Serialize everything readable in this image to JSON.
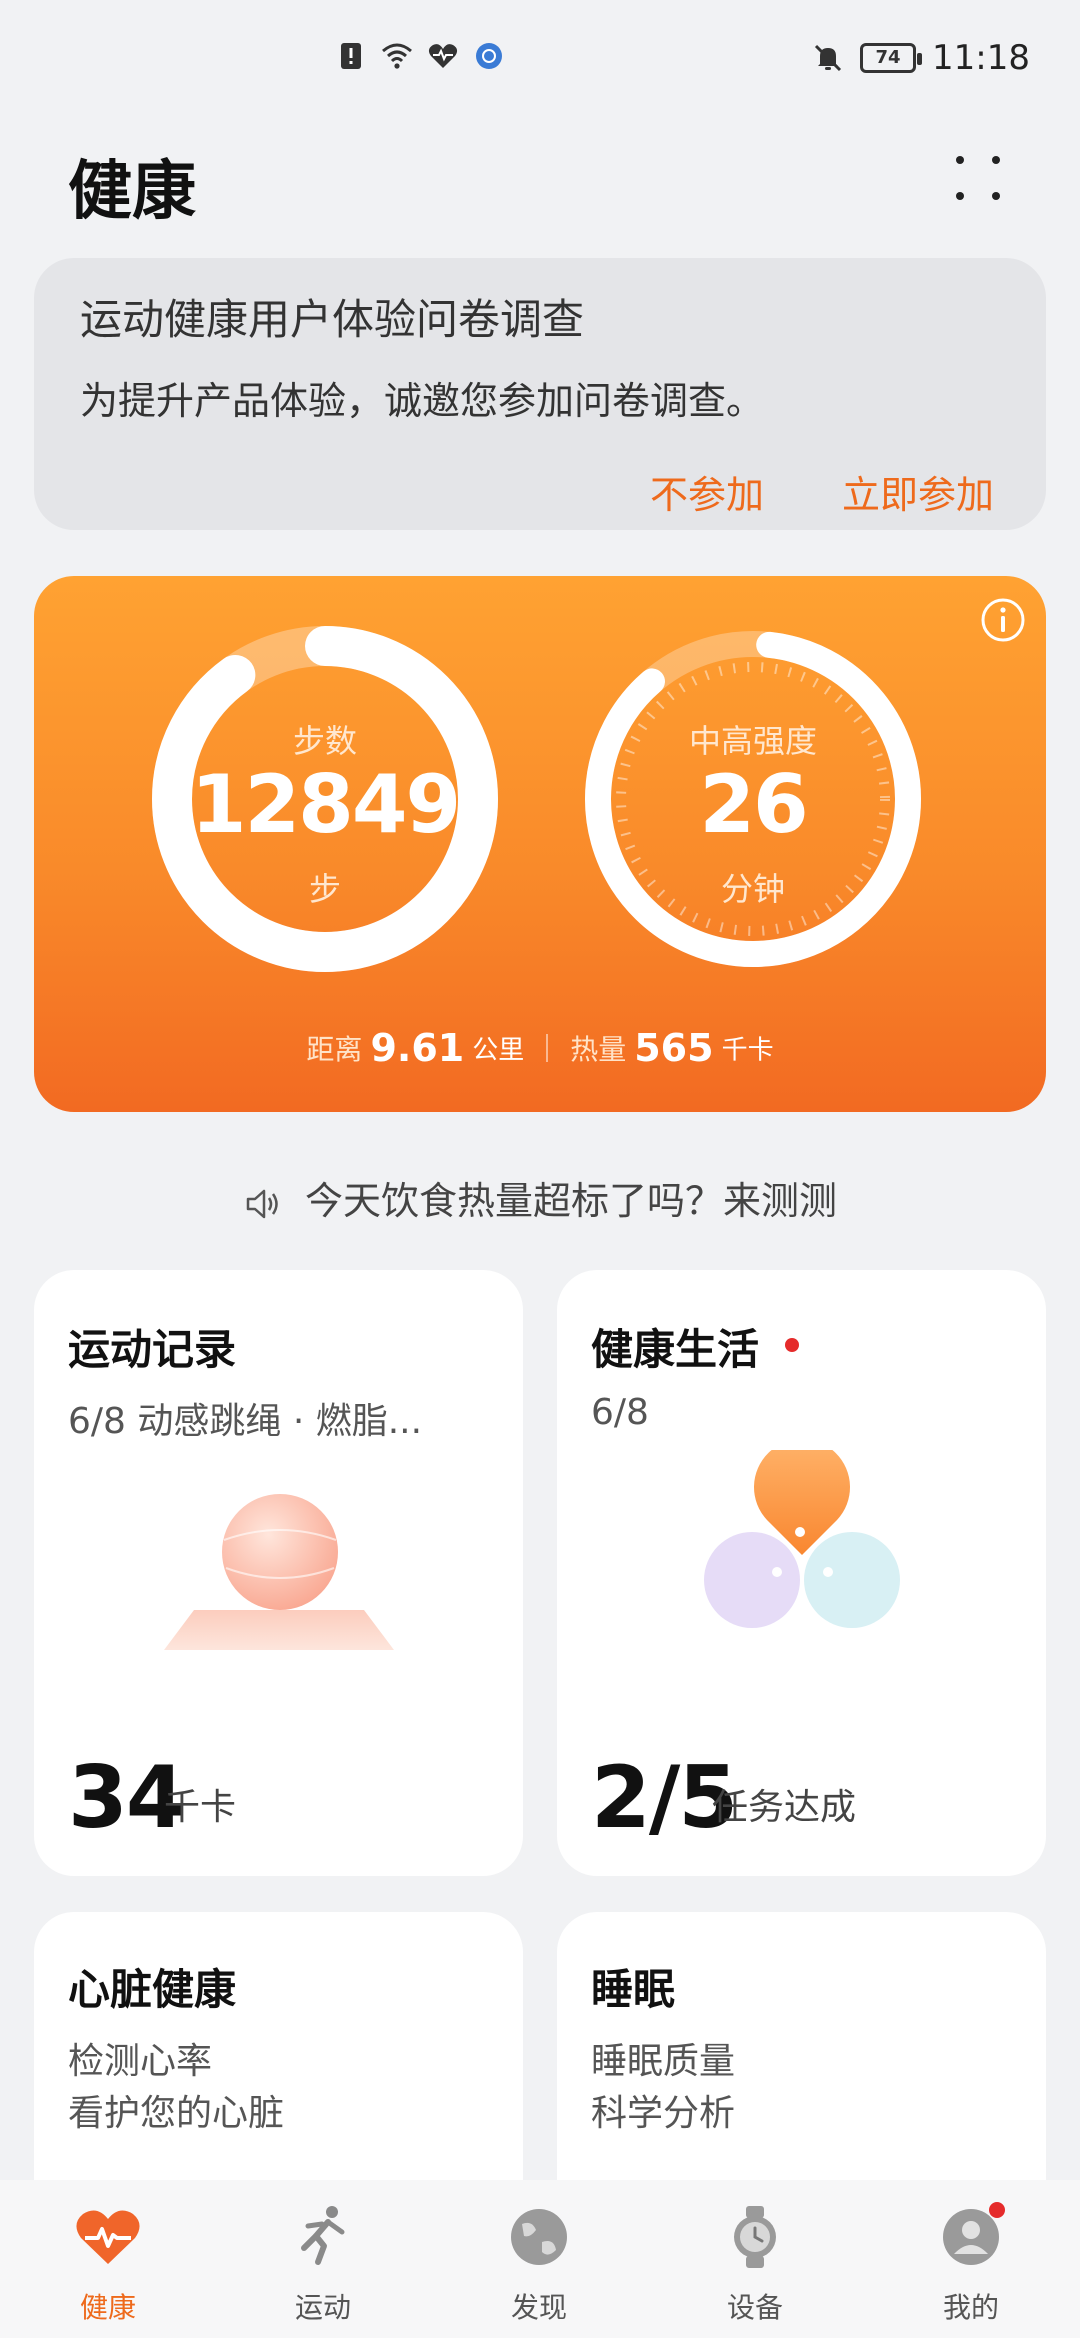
{
  "status_bar": {
    "time": "11:18",
    "battery": "74"
  },
  "header": {
    "title": "健康"
  },
  "survey": {
    "title": "运动健康用户体验问卷调查",
    "description": "为提升产品体验，诚邀您参加问卷调查。",
    "decline_label": "不参加",
    "join_label": "立即参加"
  },
  "activity": {
    "steps": {
      "label": "步数",
      "value": "12849",
      "unit": "步",
      "progress": 0.9
    },
    "intensity": {
      "label": "中高强度",
      "value": "26",
      "unit": "分钟",
      "progress": 0.87
    },
    "distance": {
      "label": "距离",
      "value": "9.61",
      "unit": "公里"
    },
    "calories": {
      "label": "热量",
      "value": "565",
      "unit": "千卡"
    }
  },
  "diet_tip": "今天饮食热量超标了吗？来测测",
  "tiles": {
    "exercise": {
      "title": "运动记录",
      "subtitle": "6/8 动感跳绳 · 燃脂...",
      "value": "34",
      "unit": "千卡"
    },
    "healthy_living": {
      "title": "健康生活",
      "subtitle": "6/8",
      "value": "2/5",
      "unit": "任务达成"
    },
    "heart": {
      "title": "心脏健康",
      "line1": "检测心率",
      "line2": "看护您的心脏"
    },
    "sleep": {
      "title": "睡眠",
      "line1": "睡眠质量",
      "line2": "科学分析"
    }
  },
  "nav": [
    {
      "label": "健康",
      "icon": "heart-icon",
      "active": true
    },
    {
      "label": "运动",
      "icon": "running-icon",
      "active": false
    },
    {
      "label": "发现",
      "icon": "globe-icon",
      "active": false
    },
    {
      "label": "设备",
      "icon": "watch-icon",
      "active": false
    },
    {
      "label": "我的",
      "icon": "profile-icon",
      "active": false
    }
  ],
  "colors": {
    "accent": "#ee6a1c",
    "card_orange": "#f98a2a",
    "notification_dot": "#e52b2b"
  }
}
